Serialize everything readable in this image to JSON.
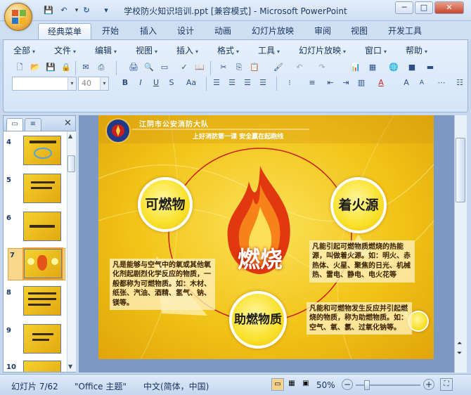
{
  "window": {
    "title": "学校防火知识培训.ppt [兼容模式] - Microsoft PowerPoint",
    "minimize_label": "─",
    "maximize_label": "□",
    "close_label": "✕"
  },
  "quick_access": [
    "save-icon",
    "undo-icon",
    "redo-icon",
    "customize-icon"
  ],
  "tabs": [
    {
      "label": "经典菜单",
      "active": true
    },
    {
      "label": "开始"
    },
    {
      "label": "插入"
    },
    {
      "label": "设计"
    },
    {
      "label": "动画"
    },
    {
      "label": "幻灯片放映"
    },
    {
      "label": "审阅"
    },
    {
      "label": "视图"
    },
    {
      "label": "开发工具"
    }
  ],
  "menu": [
    "全部",
    "文件",
    "编辑",
    "视图",
    "插入",
    "格式",
    "工具",
    "幻灯片放映",
    "窗口",
    "帮助"
  ],
  "font_combo": {
    "name": "",
    "size": "40"
  },
  "format_buttons": [
    "B",
    "I",
    "U",
    "S",
    "Aa"
  ],
  "slide_panel": {
    "thumbnails": [
      {
        "num": "4"
      },
      {
        "num": "5"
      },
      {
        "num": "6"
      },
      {
        "num": "7",
        "selected": true
      },
      {
        "num": "8"
      },
      {
        "num": "9"
      },
      {
        "num": "10"
      }
    ]
  },
  "slide": {
    "header_org": "江阴市公安消防大队",
    "header_slogan": "上好消防第一课  安全赢在起跑线",
    "center": "燃烧",
    "nodes": {
      "combustible": "可燃物",
      "ignition": "着火源",
      "oxidizer": "助燃物质"
    },
    "desc_combustible": "凡是能够与空气中的氧或其他氧化剂起剧烈化学反应的物质，一般都称为可燃物质。如：木材、纸张、汽油、酒精、氢气、钠、镁等。",
    "desc_ignition": "凡能引起可燃物质燃烧的热能源，叫做着火源。如：明火、赤热体、火星、聚焦的日光、机械热、雷电、静电、电火花等",
    "desc_oxidizer": "凡能和可燃物发生反应并引起燃烧的物质，称为助燃物质。如：空气、氧、氯、过氧化钠等。"
  },
  "status": {
    "slide_info": "幻灯片 7/62",
    "theme": "\"Office 主题\"",
    "language": "中文(简体，中国)",
    "zoom": "50%"
  },
  "colors": {
    "accent": "#f2c418",
    "ribbon": "#d6e5f7",
    "frame": "#c5d8ee"
  }
}
